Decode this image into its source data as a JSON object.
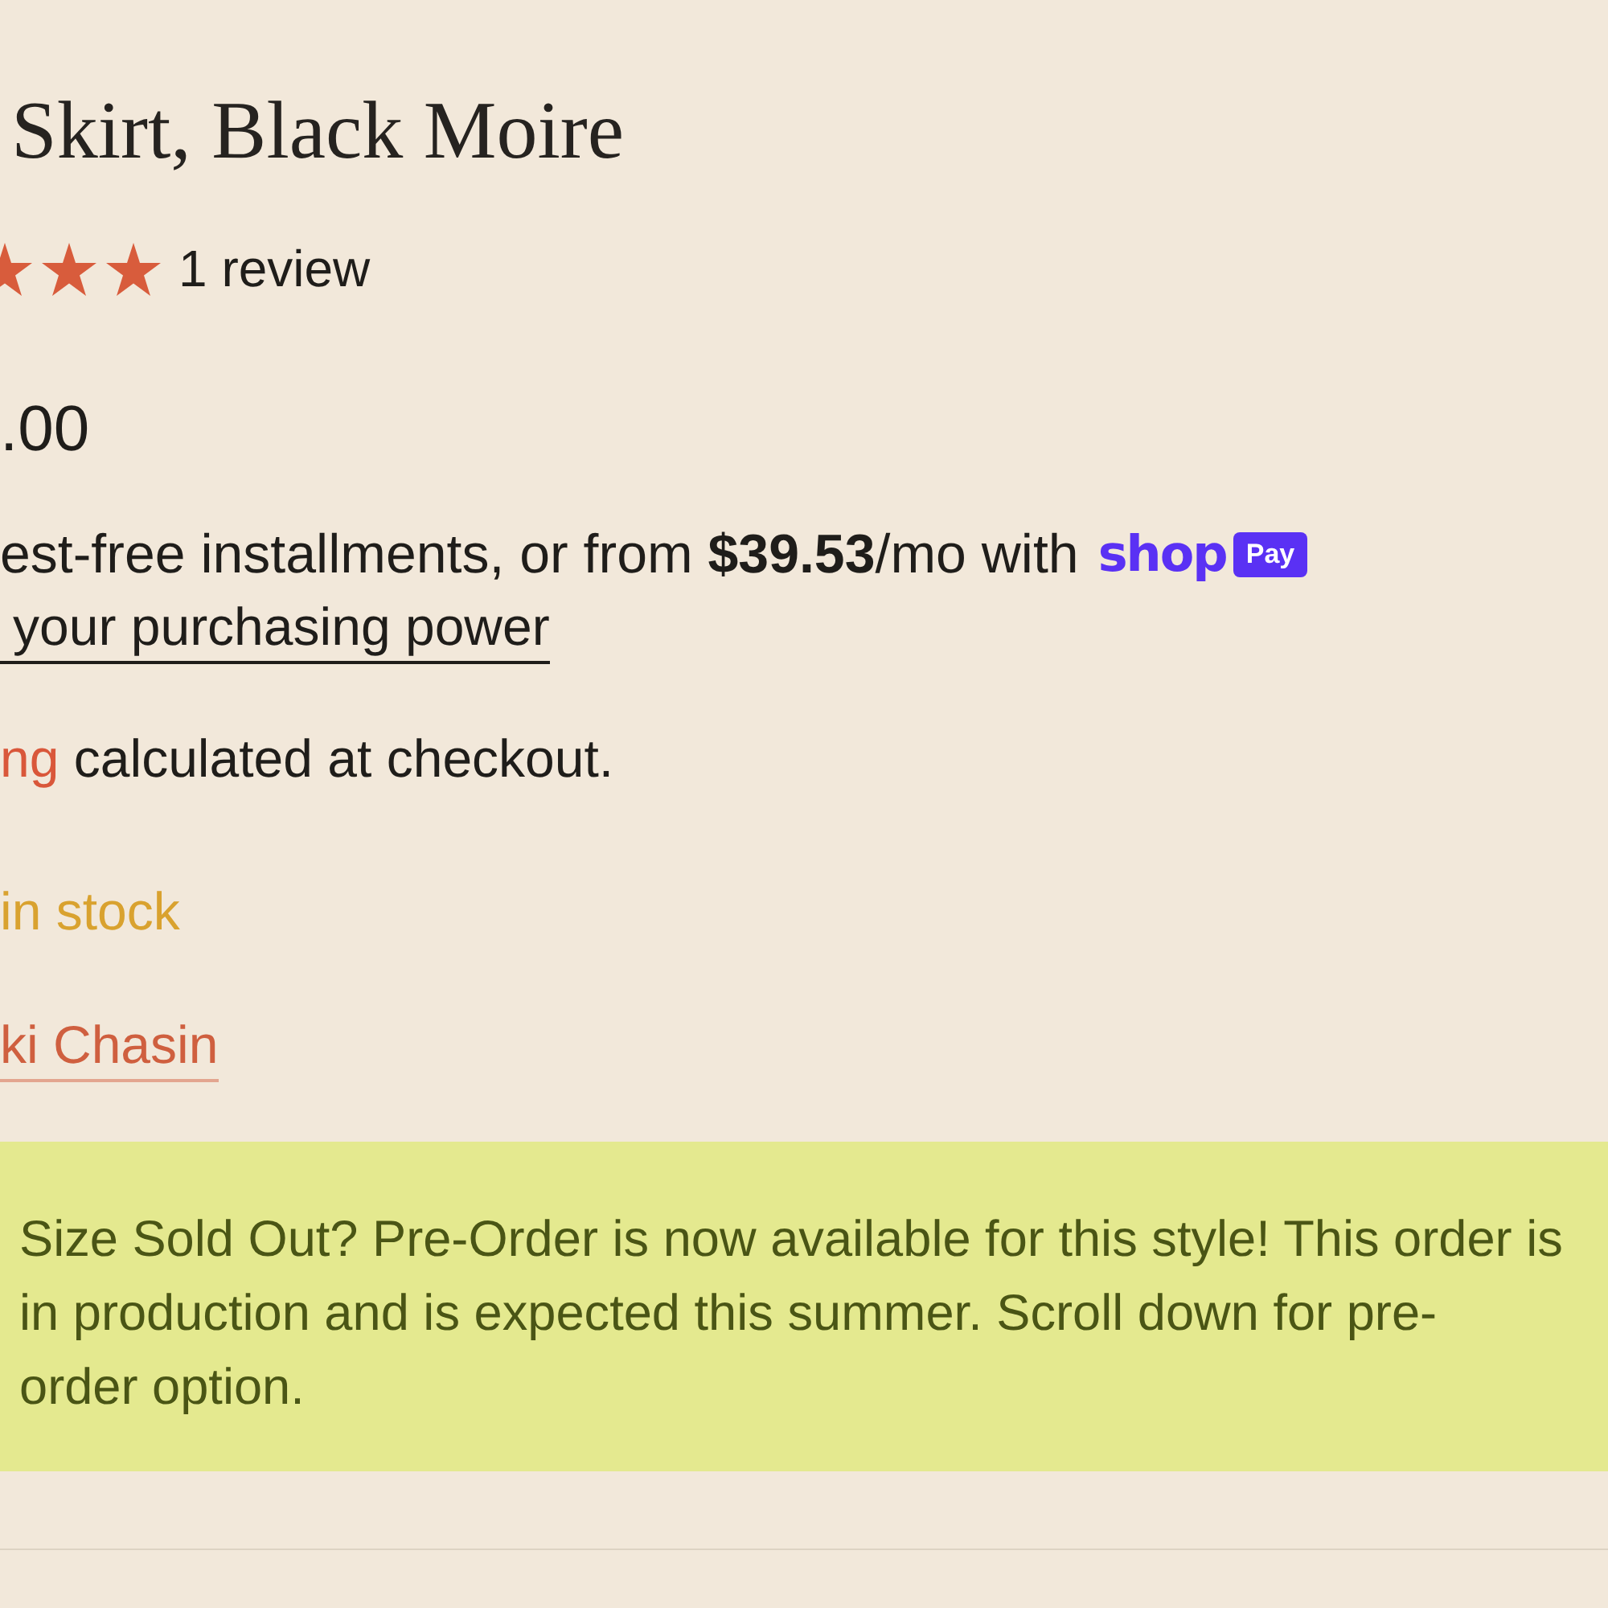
{
  "product": {
    "title": "Skirt, Black Moire",
    "rating": {
      "stars": 3,
      "review_count": "1 review"
    },
    "price": ".00",
    "installments": {
      "text": "est-free installments, or from **$39.53**/mo with",
      "shop_pay": {
        "wordmark": "shop",
        "badge": "Pay"
      }
    },
    "purchasing_power_link": "your purchasing power",
    "shipping_note": {
      "link": "ng",
      "text": "calculated at checkout."
    },
    "stock_status": "in stock",
    "designer_link": "ki Chasin"
  },
  "notice_banner": {
    "text": "Size Sold Out? Pre-Order is now available for this style! This order is in production and is expected this summer. Scroll down for pre-order option."
  }
}
